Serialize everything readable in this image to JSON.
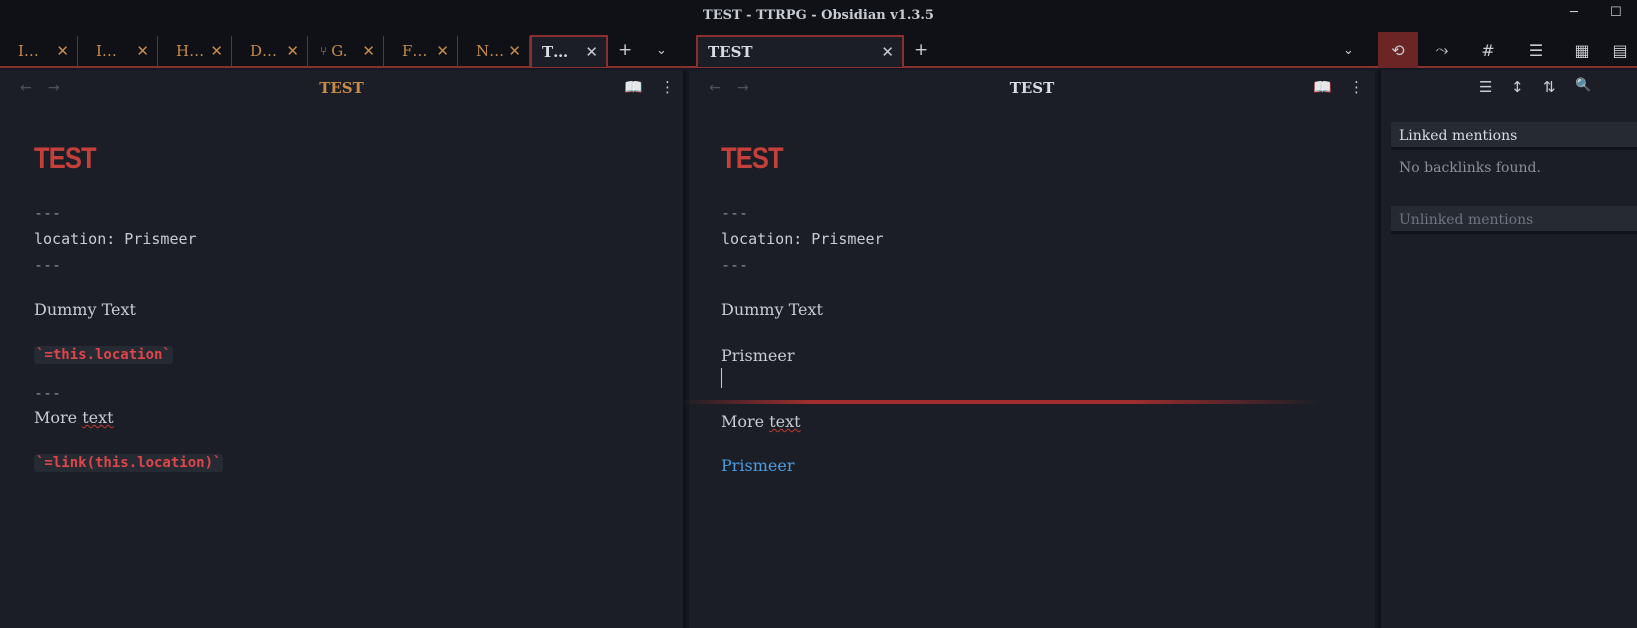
{
  "window": {
    "title": "TEST - TTRPG - Obsidian v1.3.5",
    "minimize": "─",
    "maximize": "☐"
  },
  "tabs_left": [
    {
      "label": "I…",
      "close": "✕"
    },
    {
      "label": "I…",
      "close": "✕"
    },
    {
      "label": "H…",
      "close": "✕"
    },
    {
      "label": "D…",
      "close": "✕"
    },
    {
      "label": "G.",
      "close": "✕",
      "icon": "graph-icon"
    },
    {
      "label": "F…",
      "close": "✕"
    },
    {
      "label": "N…",
      "close": "✕"
    },
    {
      "label": "T…",
      "close": "✕",
      "active": true
    }
  ],
  "tabs_right": [
    {
      "label": "TEST",
      "close": "✕",
      "active": true
    }
  ],
  "tab_controls": {
    "new_tab": "+",
    "tab_list": "⌄"
  },
  "sidebar_tabs": [
    {
      "icon": "backlinks-icon",
      "glyph": "⟲",
      "active": true
    },
    {
      "icon": "outgoing-links-icon",
      "glyph": "⤳"
    },
    {
      "icon": "tags-icon",
      "glyph": "#"
    },
    {
      "icon": "outline-icon",
      "glyph": "☰"
    },
    {
      "icon": "calendar-icon",
      "glyph": "▦"
    },
    {
      "icon": "table-icon",
      "glyph": "▤"
    }
  ],
  "left_pane": {
    "title": "TEST",
    "title_color": "#c98b4a",
    "heading": "TEST",
    "frontmatter_open": "---",
    "frontmatter_line": "location: Prismeer",
    "frontmatter_close": "---",
    "dummy": "Dummy Text",
    "inline_query": "`=this.location`",
    "hr": "---",
    "more_prefix": "More ",
    "more_word": "text",
    "inline_link_query": "`=link(this.location)`"
  },
  "right_pane": {
    "title": "TEST",
    "heading": "TEST",
    "frontmatter_open": "---",
    "frontmatter_line": "location: Prismeer",
    "frontmatter_close": "---",
    "dummy": "Dummy Text",
    "query_result": "Prismeer",
    "more_prefix": "More ",
    "more_word": "text",
    "link_result": "Prismeer"
  },
  "nav": {
    "back": "←",
    "forward": "→",
    "reading_view": "📖",
    "more": "⋮"
  },
  "sidebar": {
    "toolbar": {
      "collapse": "☰",
      "expand": "↕",
      "sort": "⇅",
      "search": "🔍"
    },
    "linked_mentions": "Linked mentions",
    "no_backlinks": "No backlinks found.",
    "unlinked_mentions": "Unlinked mentions"
  },
  "colors": {
    "accent": "#8b2e2e",
    "heading": "#c5403a",
    "tab_text": "#c98b4a",
    "link": "#4d9de0",
    "code": "#e0454a"
  }
}
